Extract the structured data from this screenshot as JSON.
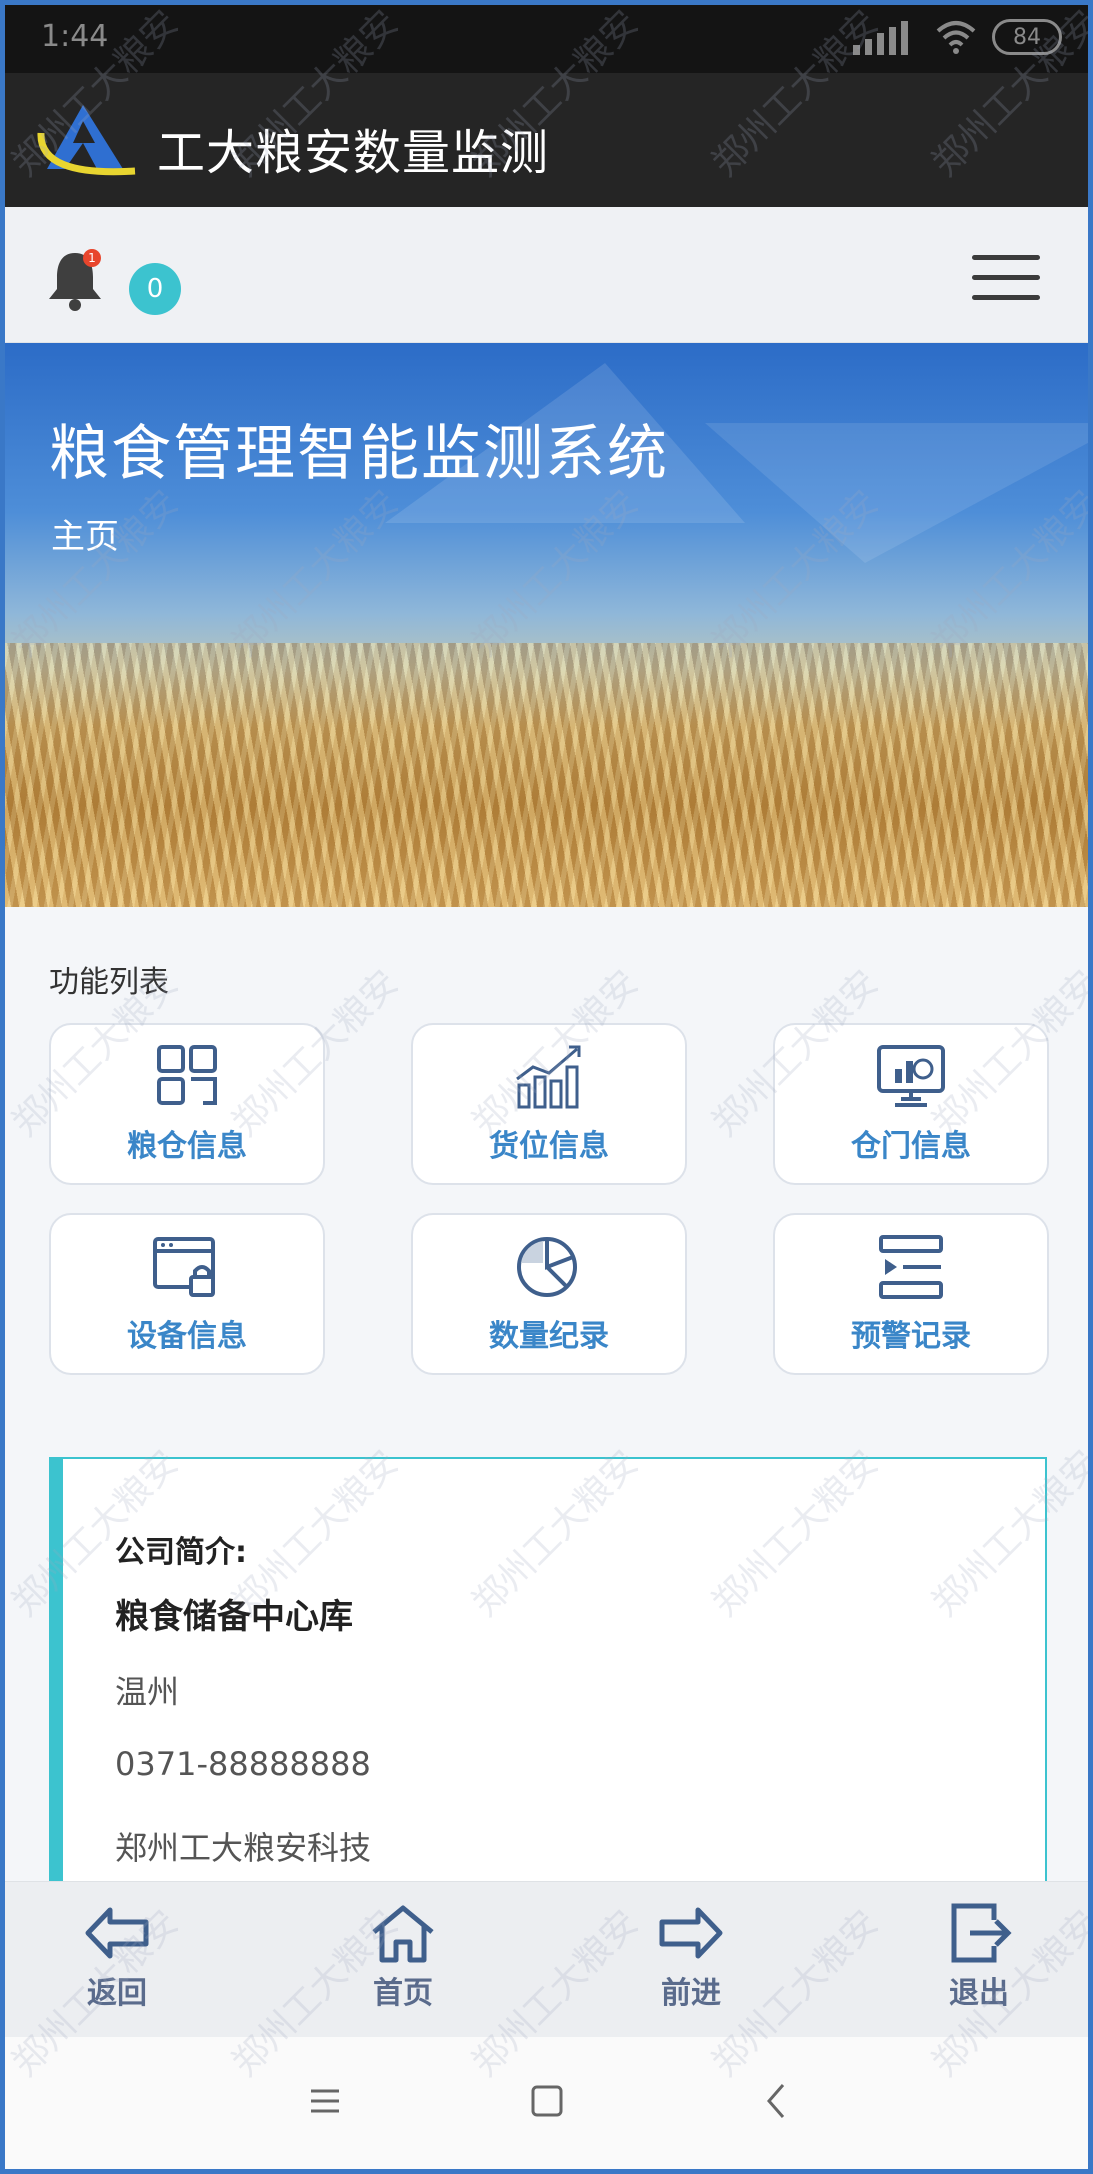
{
  "status_bar": {
    "time": "1:44",
    "battery": "84"
  },
  "app": {
    "title": "工大粮安数量监测"
  },
  "toolbar": {
    "bell_badge": "1",
    "count": "0"
  },
  "hero": {
    "title": "粮食管理智能监测系统",
    "breadcrumb": "主页"
  },
  "functions": {
    "label": "功能列表",
    "items": [
      {
        "label": "粮仓信息",
        "icon": "grid-icon"
      },
      {
        "label": "货位信息",
        "icon": "bar-growth-icon"
      },
      {
        "label": "仓门信息",
        "icon": "monitor-chart-icon"
      },
      {
        "label": "设备信息",
        "icon": "window-lock-icon"
      },
      {
        "label": "数量纪录",
        "icon": "pie-chart-icon"
      },
      {
        "label": "预警记录",
        "icon": "list-play-icon"
      }
    ]
  },
  "company": {
    "heading": "公司简介:",
    "name": "粮食储备中心库",
    "city": "温州",
    "phone": "0371-88888888",
    "firm": "郑州工大粮安科技"
  },
  "bottom_nav": {
    "back": "返回",
    "home": "首页",
    "forward": "前进",
    "exit": "退出"
  },
  "watermark": "郑州工大粮安",
  "colors": {
    "accent": "#3cc3cf",
    "tile_text": "#3a86c8",
    "nav_text": "#5a6b8c"
  }
}
